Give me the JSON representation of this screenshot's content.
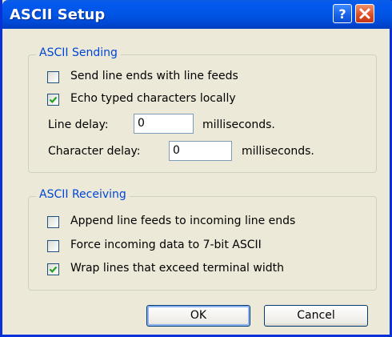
{
  "window": {
    "title": "ASCII Setup"
  },
  "title_buttons": [
    {
      "icon": "help-icon",
      "label": "?"
    },
    {
      "icon": "close-icon"
    }
  ],
  "sending": {
    "legend": "ASCII Sending",
    "send_line_feeds": {
      "label": "Send line ends with line feeds",
      "checked": false
    },
    "echo_locally": {
      "label": "Echo typed characters locally",
      "checked": true
    },
    "line_delay": {
      "label": "Line delay:",
      "value": "0",
      "unit": "milliseconds."
    },
    "char_delay": {
      "label": "Character delay:",
      "value": "0",
      "unit": "milliseconds."
    }
  },
  "receiving": {
    "legend": "ASCII Receiving",
    "append_line_feeds": {
      "label": "Append line feeds to incoming line ends",
      "checked": false
    },
    "force_7bit": {
      "label": "Force incoming data to 7-bit ASCII",
      "checked": false
    },
    "wrap_lines": {
      "label": "Wrap lines that exceed terminal width",
      "checked": true
    }
  },
  "buttons": {
    "ok": "OK",
    "cancel": "Cancel"
  },
  "colors": {
    "title_bar": "#0055e5",
    "legend_text": "#0046d5",
    "dialog_bg": "#ece9d8",
    "check_mark": "#21a121"
  }
}
